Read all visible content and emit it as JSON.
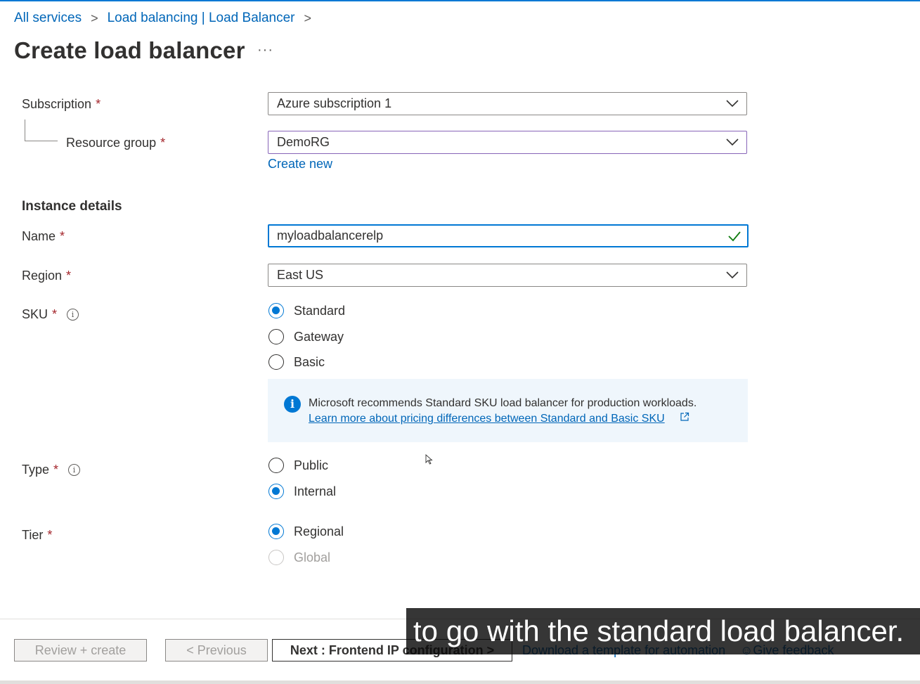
{
  "breadcrumb": {
    "items": [
      "All services",
      "Load balancing | Load Balancer"
    ],
    "separator": ">"
  },
  "page": {
    "title": "Create load balancer",
    "more": "···"
  },
  "project": {
    "subscription_label": "Subscription",
    "subscription_value": "Azure subscription 1",
    "resource_group_label": "Resource group",
    "resource_group_value": "DemoRG",
    "create_new": "Create new",
    "required_mark": "*"
  },
  "instance": {
    "heading": "Instance details",
    "name_label": "Name",
    "name_value": "myloadbalancerelp",
    "region_label": "Region",
    "region_value": "East US",
    "sku_label": "SKU",
    "sku_options": [
      "Standard",
      "Gateway",
      "Basic"
    ],
    "sku_selected": "Standard",
    "info_message": "Microsoft recommends Standard SKU load balancer for production workloads.",
    "info_link": "Learn more about pricing differences between Standard and Basic SKU",
    "type_label": "Type",
    "type_options": [
      "Public",
      "Internal"
    ],
    "type_selected": "Internal",
    "tier_label": "Tier",
    "tier_options": [
      "Regional",
      "Global"
    ],
    "tier_selected": "Regional"
  },
  "footer": {
    "review_create": "Review + create",
    "previous": "< Previous",
    "next": "Next : Frontend IP configuration >",
    "download_template": "Download a template for automation",
    "give_feedback": "Give feedback"
  },
  "caption": {
    "text": "to go with the standard load balancer."
  },
  "colors": {
    "accent": "#0078d4",
    "link": "#0066b8",
    "required": "#a4262c",
    "valid_check": "#107c10",
    "info_bg": "#eff6fc"
  },
  "icons": [
    "chevron-down-icon",
    "check-icon",
    "info-icon",
    "external-link-icon",
    "feedback-icon"
  ]
}
